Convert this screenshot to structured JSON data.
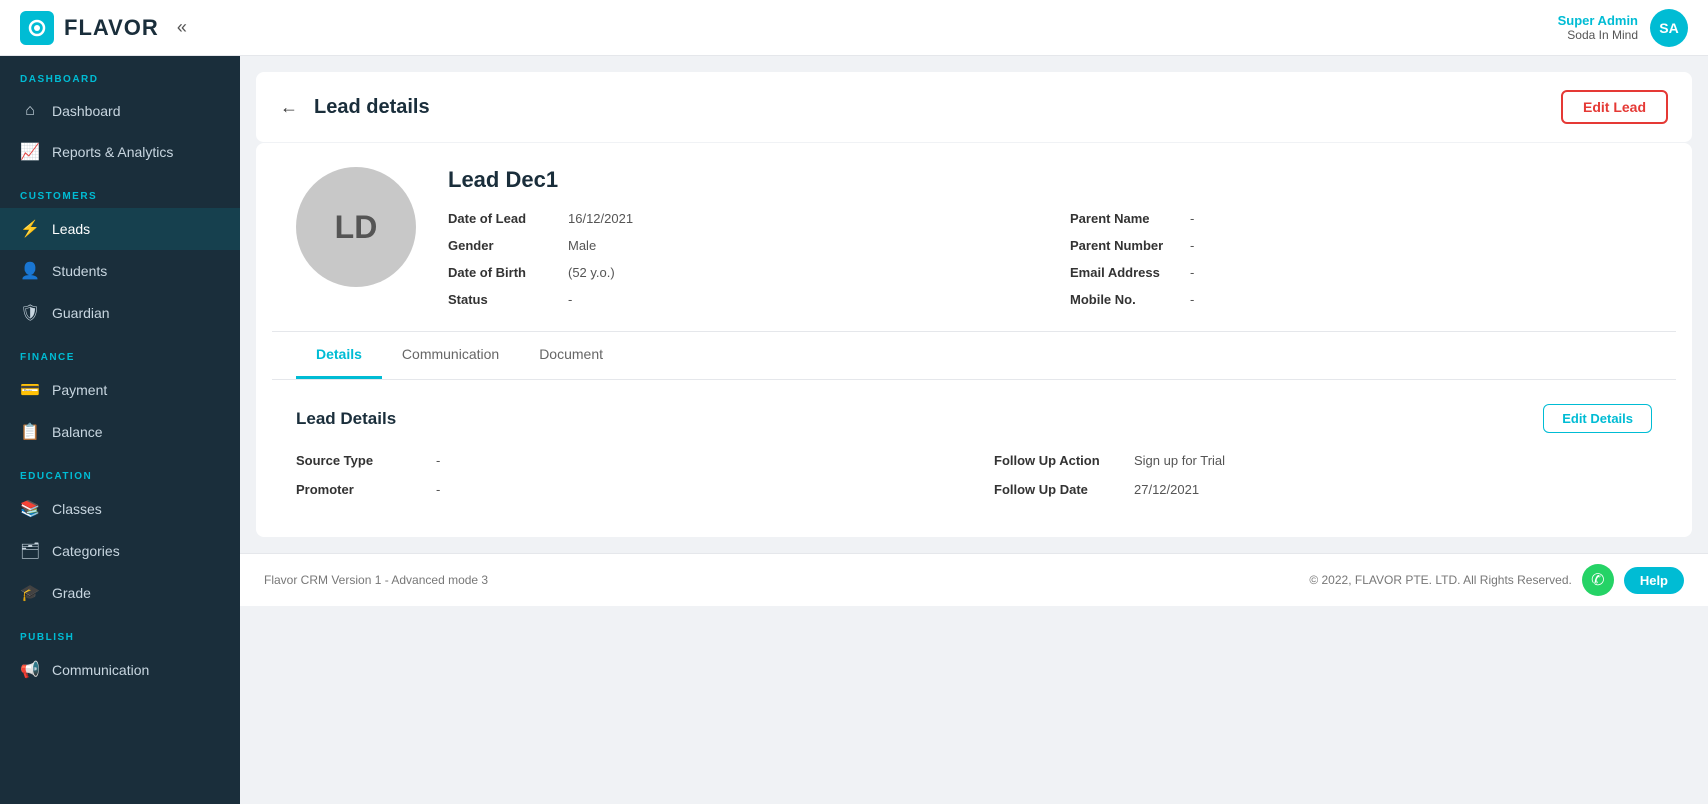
{
  "header": {
    "logo_text": "FLAVOR",
    "user_role": "Super Admin",
    "user_company": "Soda In Mind",
    "user_initials": "SA"
  },
  "sidebar": {
    "sections": [
      {
        "label": "DASHBOARD",
        "items": [
          {
            "id": "dashboard",
            "label": "Dashboard",
            "icon": "⌂"
          },
          {
            "id": "reports",
            "label": "Reports & Analytics",
            "icon": "📈"
          }
        ]
      },
      {
        "label": "CUSTOMERS",
        "items": [
          {
            "id": "leads",
            "label": "Leads",
            "icon": "⚡",
            "active": true
          },
          {
            "id": "students",
            "label": "Students",
            "icon": "👤"
          },
          {
            "id": "guardian",
            "label": "Guardian",
            "icon": "🛡"
          }
        ]
      },
      {
        "label": "FINANCE",
        "items": [
          {
            "id": "payment",
            "label": "Payment",
            "icon": "💳"
          },
          {
            "id": "balance",
            "label": "Balance",
            "icon": "📋"
          }
        ]
      },
      {
        "label": "EDUCATION",
        "items": [
          {
            "id": "classes",
            "label": "Classes",
            "icon": "📚"
          },
          {
            "id": "categories",
            "label": "Categories",
            "icon": "🗂"
          },
          {
            "id": "grade",
            "label": "Grade",
            "icon": "🎓"
          }
        ]
      },
      {
        "label": "PUBLISH",
        "items": [
          {
            "id": "communication",
            "label": "Communication",
            "icon": "📢"
          }
        ]
      }
    ]
  },
  "page": {
    "title": "Lead details",
    "back_label": "←",
    "edit_lead_label": "Edit Lead"
  },
  "lead": {
    "initials": "LD",
    "name": "Lead Dec1",
    "date_of_lead_label": "Date of Lead",
    "date_of_lead_value": "16/12/2021",
    "gender_label": "Gender",
    "gender_value": "Male",
    "date_of_birth_label": "Date of Birth",
    "date_of_birth_value": "(52 y.o.)",
    "status_label": "Status",
    "status_value": "-",
    "parent_name_label": "Parent Name",
    "parent_name_value": "-",
    "parent_number_label": "Parent Number",
    "parent_number_value": "-",
    "email_label": "Email Address",
    "email_value": "-",
    "mobile_label": "Mobile No.",
    "mobile_value": "-"
  },
  "tabs": [
    {
      "id": "details",
      "label": "Details",
      "active": true
    },
    {
      "id": "communication",
      "label": "Communication",
      "active": false
    },
    {
      "id": "document",
      "label": "Document",
      "active": false
    }
  ],
  "lead_details_section": {
    "title": "Lead Details",
    "edit_label": "Edit Details",
    "source_type_label": "Source Type",
    "source_type_value": "-",
    "promoter_label": "Promoter",
    "promoter_value": "-",
    "follow_up_action_label": "Follow Up Action",
    "follow_up_action_value": "Sign up for Trial",
    "follow_up_date_label": "Follow Up Date",
    "follow_up_date_value": "27/12/2021"
  },
  "footer": {
    "version": "Flavor CRM Version 1 - Advanced mode 3",
    "copyright": "© 2022, FLAVOR PTE. LTD. All Rights Reserved.",
    "help_label": "Help"
  }
}
